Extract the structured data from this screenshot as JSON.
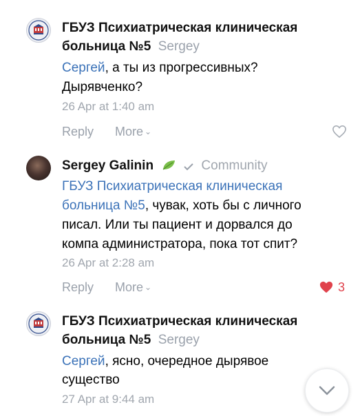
{
  "comments": [
    {
      "author": "ГБУЗ Психиатрическая клиническая",
      "author_line2": "больница №5",
      "reply_to": "Sergey",
      "mention": "Сергей",
      "text_line1_rest": ", а ты из прогрессивных?",
      "text_line2": "Дырявченко?",
      "date": "26 Apr at 1:40 am",
      "reply_label": "Reply",
      "more_label": "More"
    },
    {
      "author": "Sergey Galinin",
      "community": "Community",
      "mention_line1": "ГБУЗ Психиатрическая клиническая",
      "mention_line2": "больница №5",
      "text_line2_rest": ", чувак, хоть бы с личного",
      "text_line3": "писал. Или ты пациент и дорвался до",
      "text_line4": "компа администратора, пока тот спит?",
      "date": "26 Apr at 2:28 am",
      "reply_label": "Reply",
      "more_label": "More",
      "likes": "3"
    },
    {
      "author": "ГБУЗ Психиатрическая клиническая",
      "author_line2": "больница №5",
      "reply_to": "Sergey",
      "mention": "Сергей",
      "text_line1_rest": ", ясно, очередное дырявое",
      "text_line2": "существо",
      "date": "27 Apr at 9:44 am"
    }
  ],
  "colors": {
    "link": "#3b72b8",
    "muted": "#9aa1ab",
    "like_active": "#e0424c"
  }
}
